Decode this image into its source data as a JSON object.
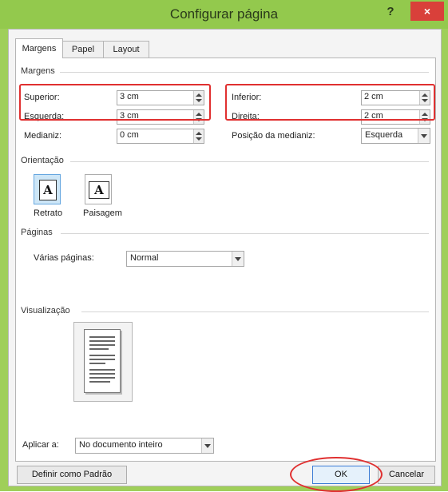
{
  "window": {
    "title": "Configurar página",
    "help_label": "?",
    "close_label": "×"
  },
  "tabs": [
    {
      "label": "Margens",
      "active": true
    },
    {
      "label": "Papel",
      "active": false
    },
    {
      "label": "Layout",
      "active": false
    }
  ],
  "margens": {
    "group_label": "Margens",
    "superior": {
      "label": "Superior:",
      "value": "3 cm"
    },
    "esquerda": {
      "label": "Esquerda:",
      "value": "3 cm"
    },
    "medianiz": {
      "label": "Medianiz:",
      "value": "0 cm"
    },
    "inferior": {
      "label": "Inferior:",
      "value": "2 cm"
    },
    "direita": {
      "label": "Direita:",
      "value": "2 cm"
    },
    "posicao_medianiz": {
      "label": "Posição da medianiz:",
      "value": "Esquerda"
    }
  },
  "orientacao": {
    "group_label": "Orientação",
    "retrato": {
      "label": "Retrato",
      "glyph": "A",
      "selected": true
    },
    "paisagem": {
      "label": "Paisagem",
      "glyph": "A",
      "selected": false
    }
  },
  "paginas": {
    "group_label": "Páginas",
    "varias_paginas": {
      "label": "Várias páginas:",
      "value": "Normal"
    }
  },
  "visualizacao": {
    "group_label": "Visualização"
  },
  "aplicar": {
    "label": "Aplicar a:",
    "value": "No documento inteiro"
  },
  "buttons": {
    "definir_padrao": "Definir como Padrão",
    "ok": "OK",
    "cancelar": "Cancelar"
  },
  "colors": {
    "titlebar": "#93c94d",
    "close": "#d9403a",
    "highlight": "#e03030"
  }
}
